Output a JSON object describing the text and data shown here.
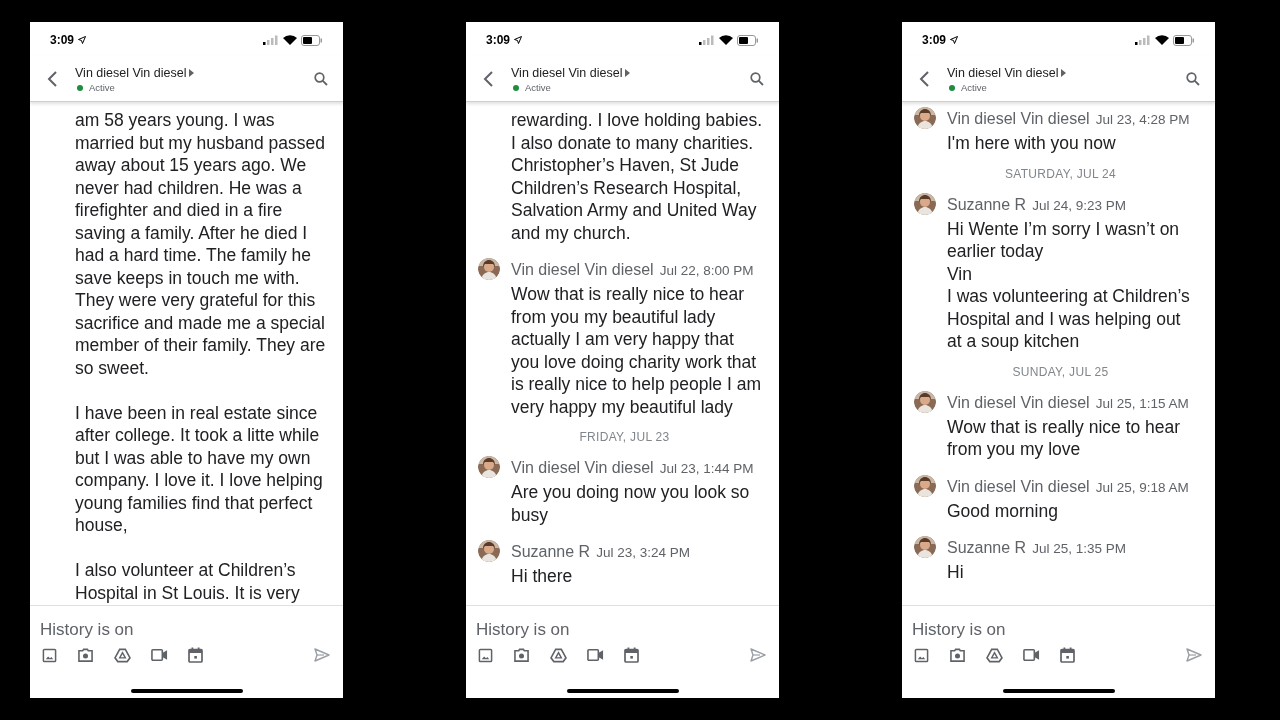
{
  "panels": [
    {
      "status_bar": {
        "time": "3:09"
      },
      "header": {
        "title": "Vin diesel Vin diesel",
        "status": "Active"
      },
      "messages": [
        {
          "kind": "text",
          "body": "am 58 years young. I was married but my husband passed away about 15 years ago. We never had children. He was a firefighter and died in a fire saving a family. After he died I had a hard time. The family he save keeps in touch me with. They were very grateful for this sacrifice and made me a special member of their family. They are so sweet."
        },
        {
          "kind": "text",
          "body": "I have been in real estate since after college. It took a litte while but I was able to have my own company. I love it. I love helping young families find that perfect house,"
        },
        {
          "kind": "text",
          "body": "I also volunteer at Children’s Hospital in St Louis. It is very"
        }
      ],
      "composer": {
        "placeholder": "History is on"
      }
    },
    {
      "status_bar": {
        "time": "3:09"
      },
      "header": {
        "title": "Vin diesel Vin diesel",
        "status": "Active"
      },
      "messages": [
        {
          "kind": "text",
          "body": "rewarding. I love holding babies. I also donate to many charities. Christopher’s Haven, St Jude Children’s Research Hospital, Salvation Army and United Way and my church."
        },
        {
          "kind": "message",
          "sender": "Vin diesel Vin diesel",
          "time": "Jul 22, 8:00 PM",
          "body": "Wow that is really nice to hear from you my beautiful lady actually I am very happy that you love doing charity work that is really nice to help people I am very happy my beautiful lady"
        },
        {
          "kind": "date",
          "label": "FRIDAY, JUL 23"
        },
        {
          "kind": "message",
          "sender": "Vin diesel Vin diesel",
          "time": "Jul 23, 1:44 PM",
          "body": "Are you doing now you look so busy"
        },
        {
          "kind": "message",
          "sender": "Suzanne R",
          "time": "Jul 23, 3:24 PM",
          "body": "Hi there"
        }
      ],
      "composer": {
        "placeholder": "History is on"
      }
    },
    {
      "status_bar": {
        "time": "3:09"
      },
      "header": {
        "title": "Vin diesel Vin diesel",
        "status": "Active"
      },
      "messages": [
        {
          "kind": "message",
          "sender": "Vin diesel Vin diesel",
          "time": "Jul 23, 4:28 PM",
          "body": "I'm here with you now"
        },
        {
          "kind": "date",
          "label": "SATURDAY, JUL 24"
        },
        {
          "kind": "message",
          "sender": "Suzanne R",
          "time": "Jul 24, 9:23 PM",
          "body": "Hi Wente I’m sorry I wasn’t on earlier today\nVin\nI was volunteering at Children’s Hospital and I was helping out at a soup kitchen"
        },
        {
          "kind": "date",
          "label": "SUNDAY, JUL 25"
        },
        {
          "kind": "message",
          "sender": "Vin diesel Vin diesel",
          "time": "Jul 25, 1:15 AM",
          "body": "Wow that is really nice to hear from you my love"
        },
        {
          "kind": "message",
          "sender": "Vin diesel Vin diesel",
          "time": "Jul 25, 9:18 AM",
          "body": "Good morning"
        },
        {
          "kind": "message",
          "sender": "Suzanne R",
          "time": "Jul 25, 1:35 PM",
          "body": "Hi"
        }
      ],
      "composer": {
        "placeholder": "History is on"
      }
    }
  ]
}
